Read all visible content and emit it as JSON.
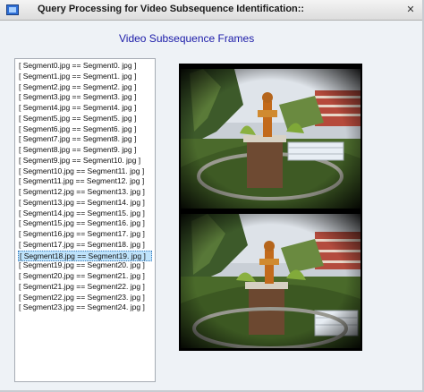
{
  "window": {
    "title": "Query Processing for Video Subsequence Identification::",
    "close_glyph": "✕"
  },
  "heading": "Video Subsequence Frames",
  "list": {
    "items": [
      "[ Segment0.jpg == Segment0. jpg ]",
      "[ Segment1.jpg == Segment1. jpg ]",
      "[ Segment2.jpg == Segment2. jpg ]",
      "[ Segment3.jpg == Segment3. jpg ]",
      "[ Segment4.jpg == Segment4. jpg ]",
      "[ Segment5.jpg == Segment5. jpg ]",
      "[ Segment6.jpg == Segment6. jpg ]",
      "[ Segment7.jpg == Segment8. jpg ]",
      "[ Segment8.jpg == Segment9. jpg ]",
      "[ Segment9.jpg == Segment10. jpg ]",
      "[ Segment10.jpg == Segment11. jpg ]",
      "[ Segment11.jpg == Segment12. jpg ]",
      "[ Segment12.jpg == Segment13. jpg ]",
      "[ Segment13.jpg == Segment14. jpg ]",
      "[ Segment14.jpg == Segment15. jpg ]",
      "[ Segment15.jpg == Segment16. jpg ]",
      "[ Segment16.jpg == Segment17. jpg ]",
      "[ Segment17.jpg == Segment18. jpg ]",
      "[ Segment18.jpg == Segment19. jpg ]",
      "[ Segment19.jpg == Segment20. jpg ]",
      "[ Segment20.jpg == Segment21. jpg ]",
      "[ Segment21.jpg == Segment22. jpg ]",
      "[ Segment22.jpg == Segment23. jpg ]",
      "[ Segment23.jpg == Segment24. jpg ]"
    ],
    "selected_index": 18
  },
  "colors": {
    "heading": "#1a1aa8",
    "selection": "#bfe3fb"
  }
}
